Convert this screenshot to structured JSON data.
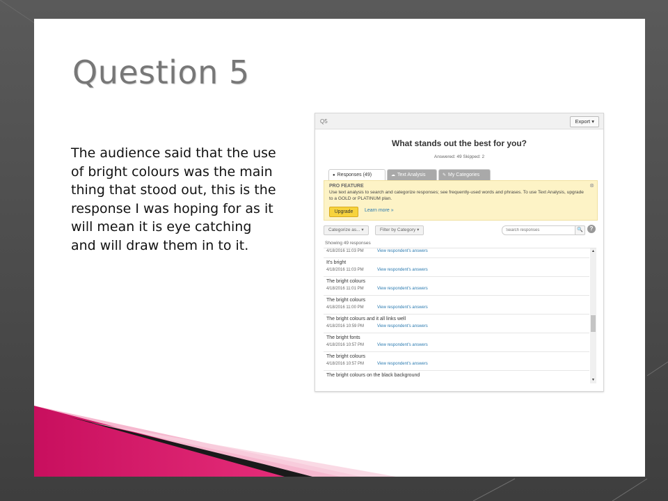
{
  "slide": {
    "title": "Question 5",
    "body": "The audience said that the use of bright colours was the main thing that stood out, this is the response I was hoping for as it will mean it is eye catching and will draw them in to it."
  },
  "colors": {
    "accent_pink": "#e0126f",
    "link_blue": "#2a7ab0",
    "promo_yellow": "#fdf3c6",
    "upgrade_yellow": "#f7d33c"
  },
  "survey": {
    "question_id": "Q5",
    "export_label": "Export ▾",
    "question": "What stands out the best for you?",
    "stats": "Answered: 49    Skipped: 2",
    "tabs": [
      {
        "icon": "●",
        "label": "Responses (49)"
      },
      {
        "icon": "☁",
        "label": "Text Analysis"
      },
      {
        "icon": "✎",
        "label": "My Categories"
      }
    ],
    "promo": {
      "title": "PRO FEATURE",
      "text": "Use text analysis to search and categorize responses; see frequently-used words and phrases. To use Text Analysis, upgrade to a GOLD or PLATINUM plan.",
      "upgrade_label": "Upgrade",
      "learn_more": "Learn more »",
      "close": "⊗"
    },
    "filters": {
      "categorize": "Categorize as... ▾",
      "filter": "Filter by Category ▾",
      "search_placeholder": "Search responses",
      "search_icon": "🔍",
      "help": "?"
    },
    "showing": "Showing 49 responses",
    "link_label": "View respondent's answers",
    "responses": [
      {
        "text": "",
        "time": "4/18/2016 11:03 PM"
      },
      {
        "text": "It's bright",
        "time": "4/18/2016 11:03 PM"
      },
      {
        "text": "The bright colours",
        "time": "4/18/2016 11:01 PM"
      },
      {
        "text": "The bright colours",
        "time": "4/18/2016 11:00 PM"
      },
      {
        "text": "The bright colours and it all links well",
        "time": "4/18/2016 10:59 PM"
      },
      {
        "text": "The bright fonts",
        "time": "4/18/2016 10:57 PM"
      },
      {
        "text": "The bright colours",
        "time": "4/18/2016 10:57 PM"
      },
      {
        "text": "The bright colours on the black background",
        "time": ""
      }
    ],
    "scroll": {
      "up": "▲",
      "down": "▼"
    }
  }
}
